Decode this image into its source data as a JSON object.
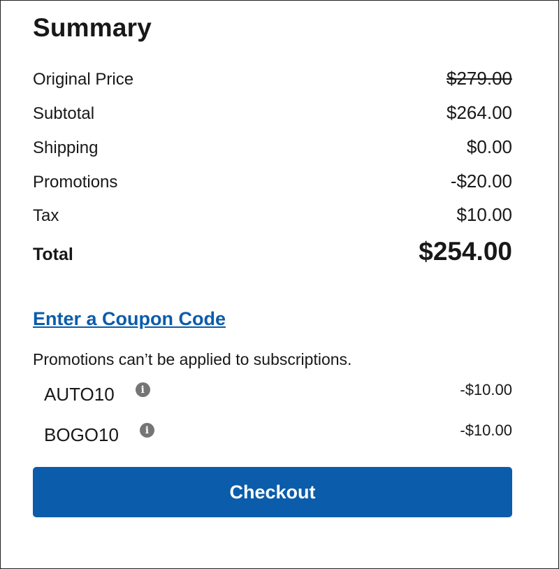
{
  "summary": {
    "title": "Summary",
    "rows": [
      {
        "label": "Original Price",
        "value": "$279.00"
      },
      {
        "label": "Subtotal",
        "value": "$264.00"
      },
      {
        "label": "Shipping",
        "value": "$0.00"
      },
      {
        "label": "Promotions",
        "value": "-$20.00"
      },
      {
        "label": "Tax",
        "value": "$10.00"
      }
    ],
    "total": {
      "label": "Total",
      "value": "$254.00"
    }
  },
  "coupon": {
    "link_label": "Enter a Coupon Code"
  },
  "promotions": {
    "note": "Promotions can’t be applied to subscriptions.",
    "items": [
      {
        "code": "AUTO10",
        "icon": "info-icon",
        "value": "-$10.00"
      },
      {
        "code": "BOGO10",
        "icon": "info-icon",
        "value": "-$10.00"
      }
    ]
  },
  "checkout": {
    "label": "Checkout"
  },
  "colors": {
    "accent": "#0b5cab",
    "info_icon": "#757575"
  }
}
